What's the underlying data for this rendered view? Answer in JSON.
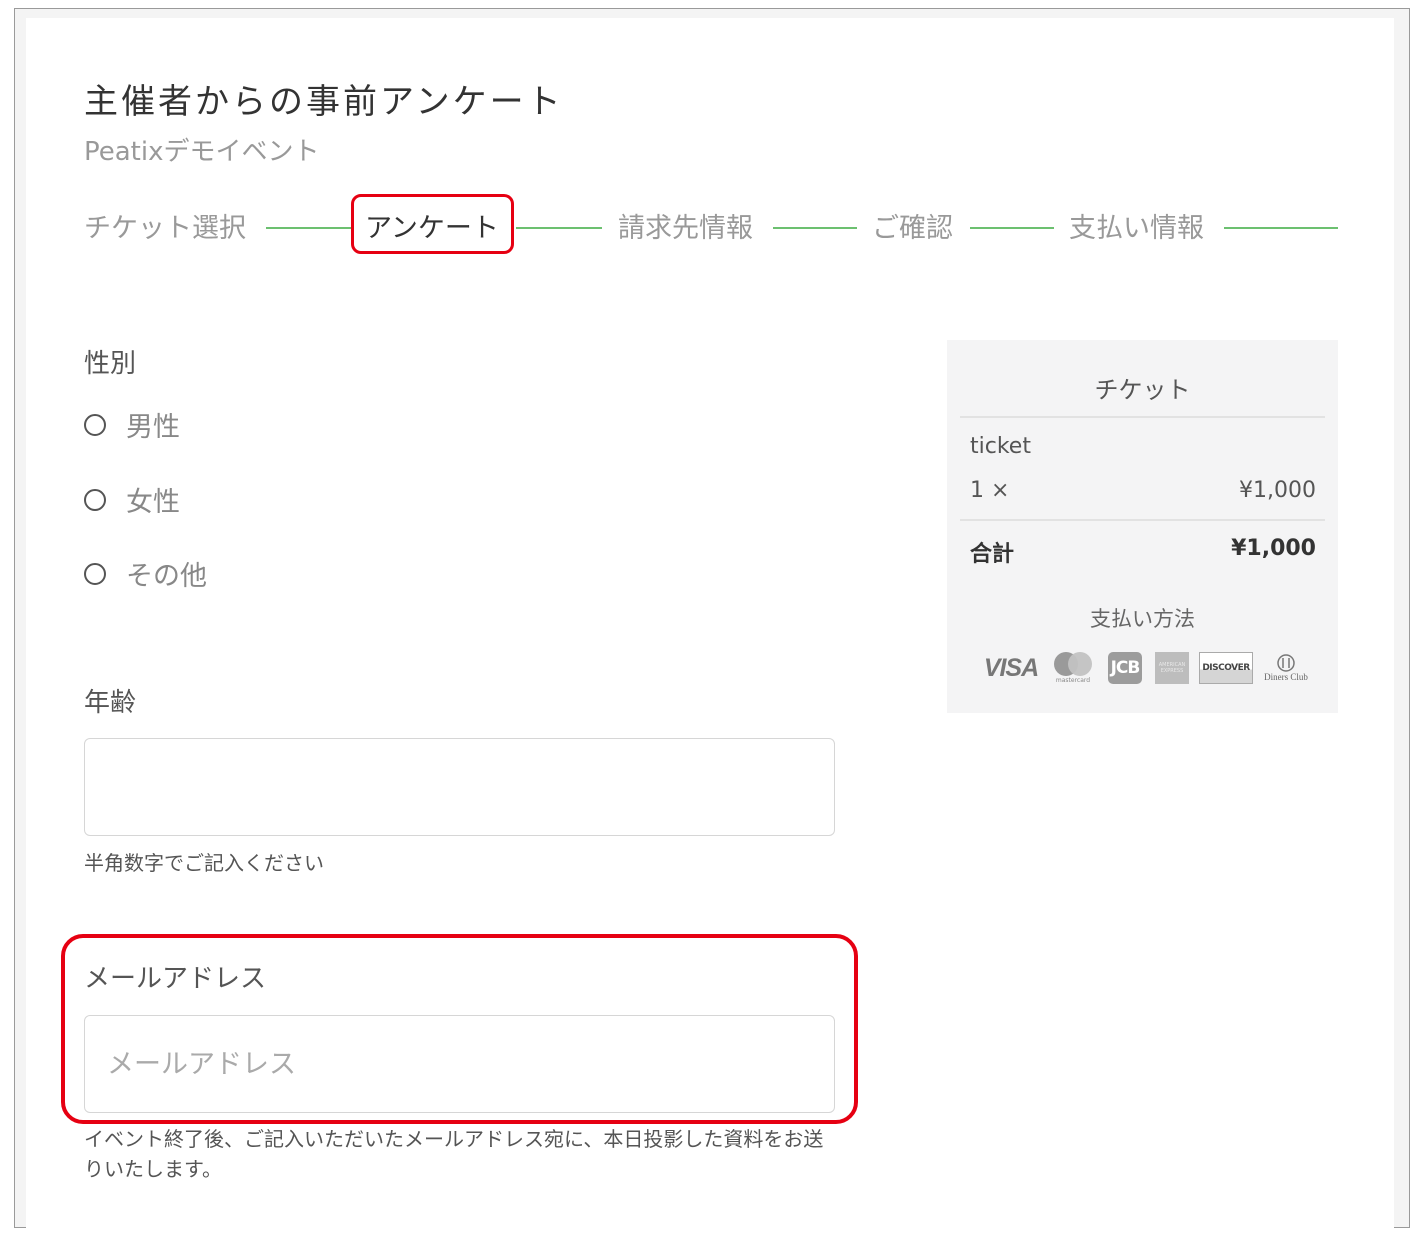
{
  "header": {
    "title": "主催者からの事前アンケート",
    "event_name": "Peatixデモイベント"
  },
  "steps": {
    "ticket": "チケット選択",
    "survey": "アンケート",
    "billing": "請求先情報",
    "confirm": "ご確認",
    "payment": "支払い情報",
    "active": "アンケート"
  },
  "form": {
    "gender": {
      "label": "性別",
      "option_male": "男性",
      "option_female": "女性",
      "option_other": "その他"
    },
    "age": {
      "label": "年齢",
      "value": "",
      "help": "半角数字でご記入ください"
    },
    "email": {
      "label": "メールアドレス",
      "value": "",
      "placeholder": "メールアドレス",
      "help": "イベント終了後、ご記入いただいたメールアドレス宛に、本日投影した資料をお送りいたします。"
    }
  },
  "summary": {
    "title": "チケット",
    "ticket_name": "ticket",
    "quantity": "1 ×",
    "price": "¥1,000",
    "total_label": "合計",
    "total_value": "¥1,000",
    "payment_title": "支払い方法",
    "cards": {
      "visa": "VISA",
      "mastercard": "mastercard",
      "jcb": "JCB",
      "amex": "AMERICAN EXPRESS",
      "discover": "DISCOVER",
      "diners": "Diners Club"
    }
  },
  "colors": {
    "accent_line": "#6cc070",
    "highlight": "#e60012"
  }
}
